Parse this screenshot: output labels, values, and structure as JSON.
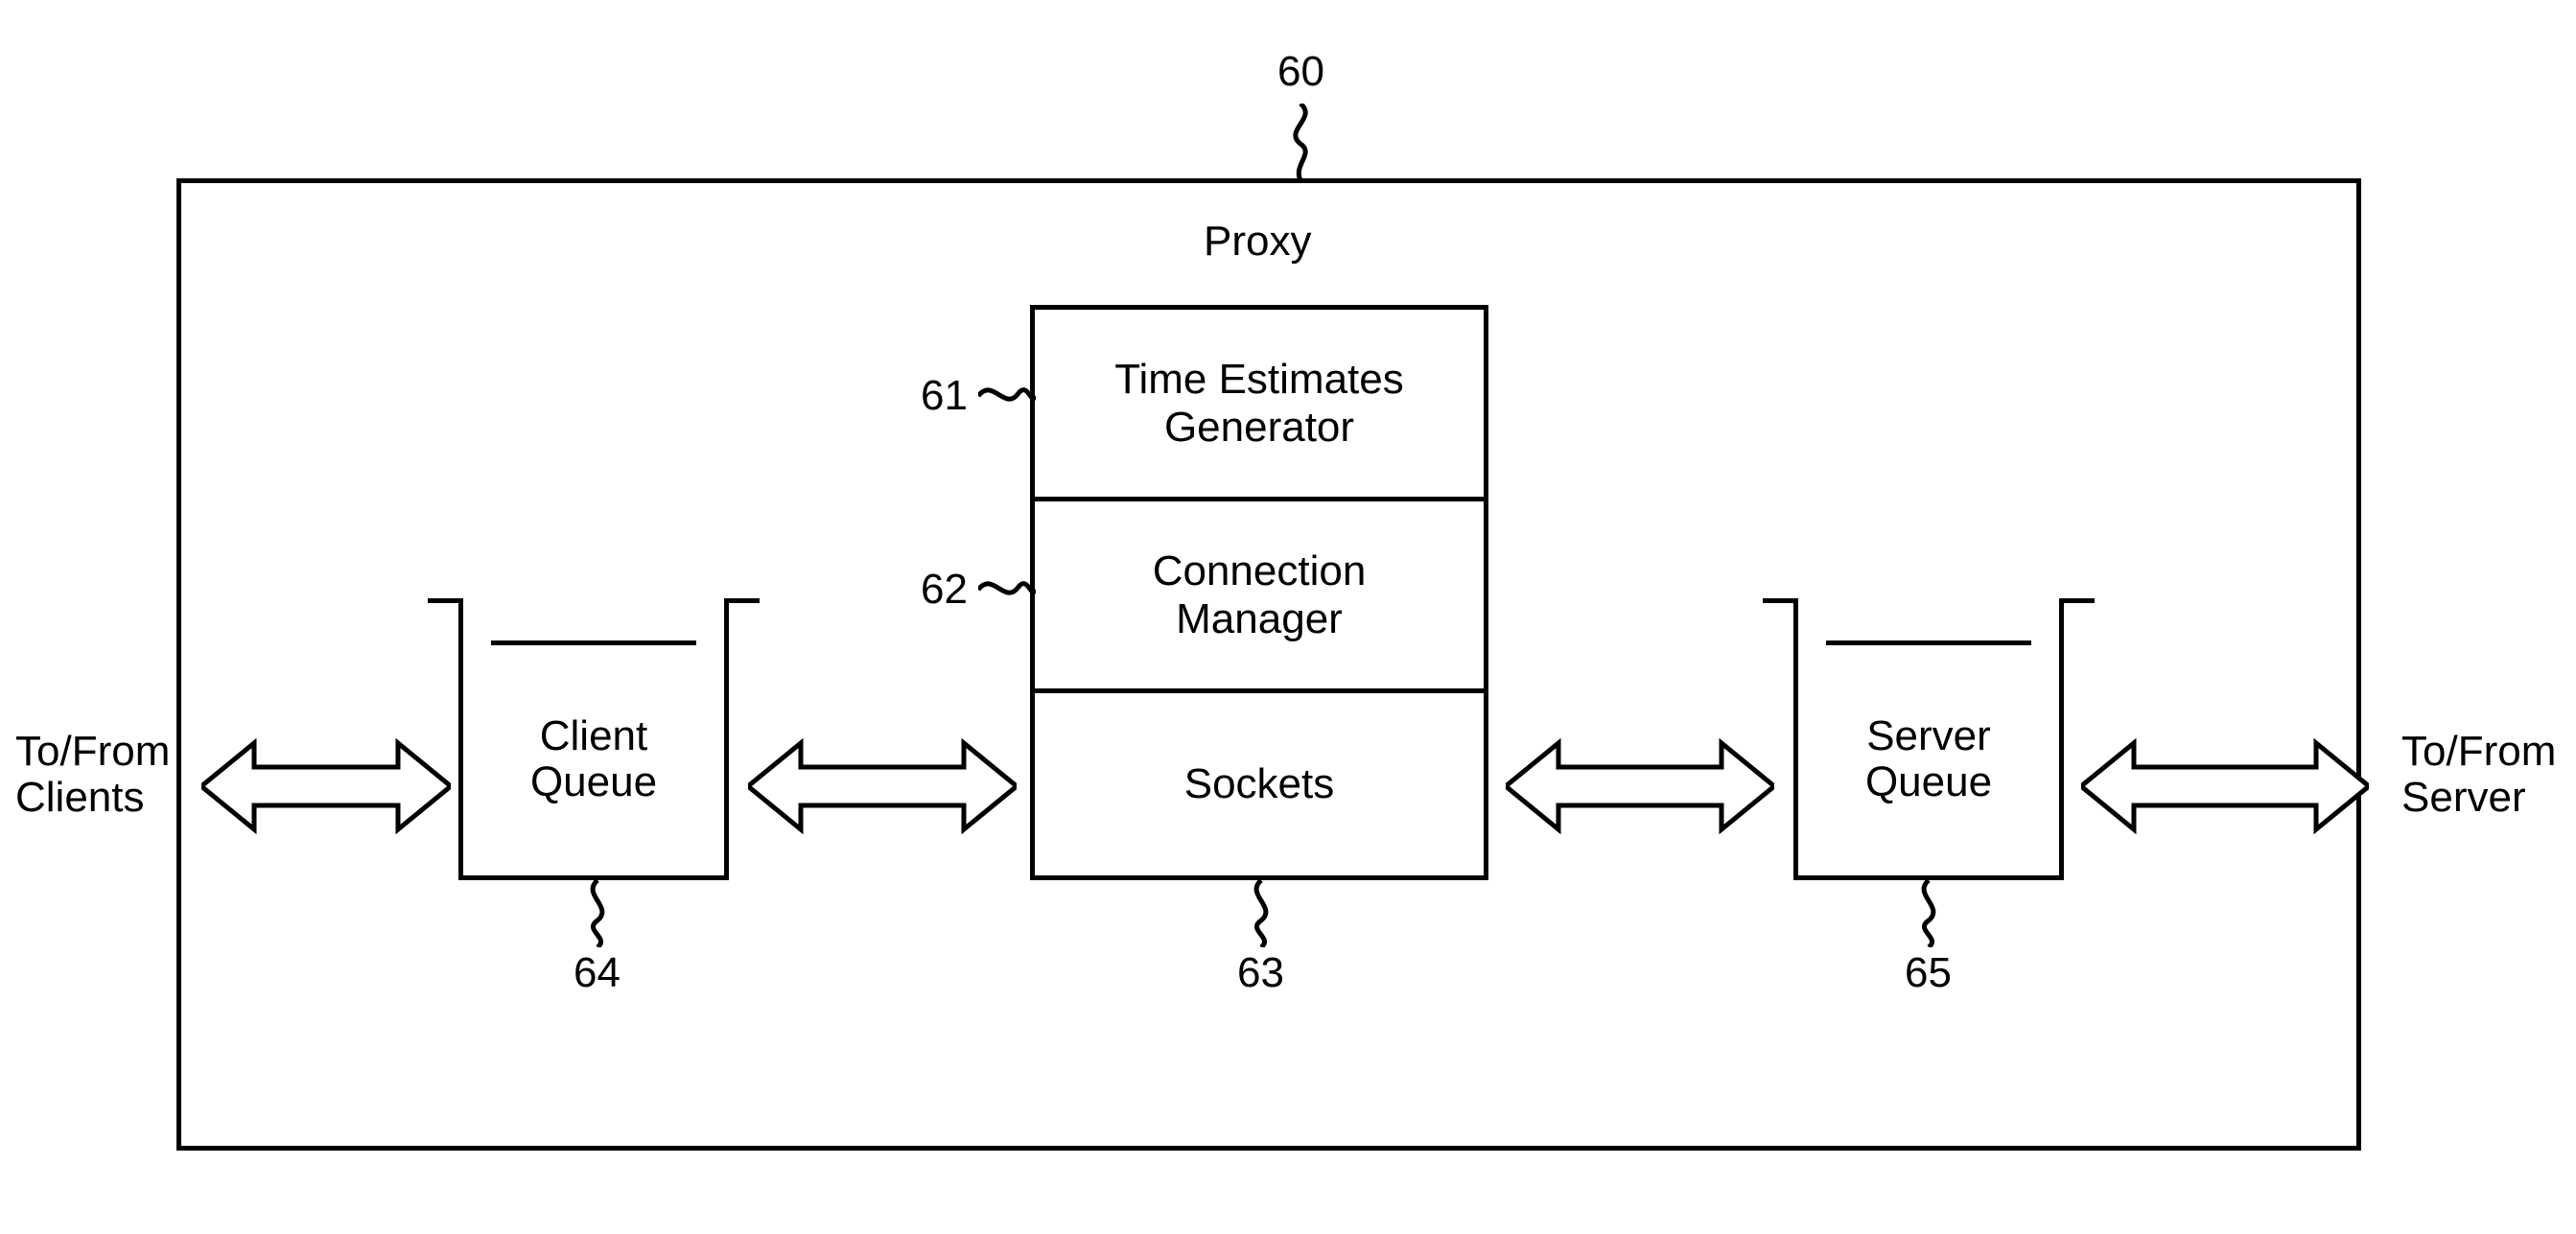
{
  "refs": {
    "proxy": "60",
    "time_estimates_generator": "61",
    "connection_manager": "62",
    "sockets": "63",
    "client_queue": "64",
    "server_queue": "65"
  },
  "labels": {
    "proxy_title": "Proxy",
    "client_queue": "Client\nQueue",
    "server_queue": "Server\nQueue",
    "time_estimates_generator": "Time Estimates\nGenerator",
    "connection_manager": "Connection\nManager",
    "sockets": "Sockets",
    "to_from_clients": "To/From\nClients",
    "to_from_server": "To/From\nServer"
  }
}
